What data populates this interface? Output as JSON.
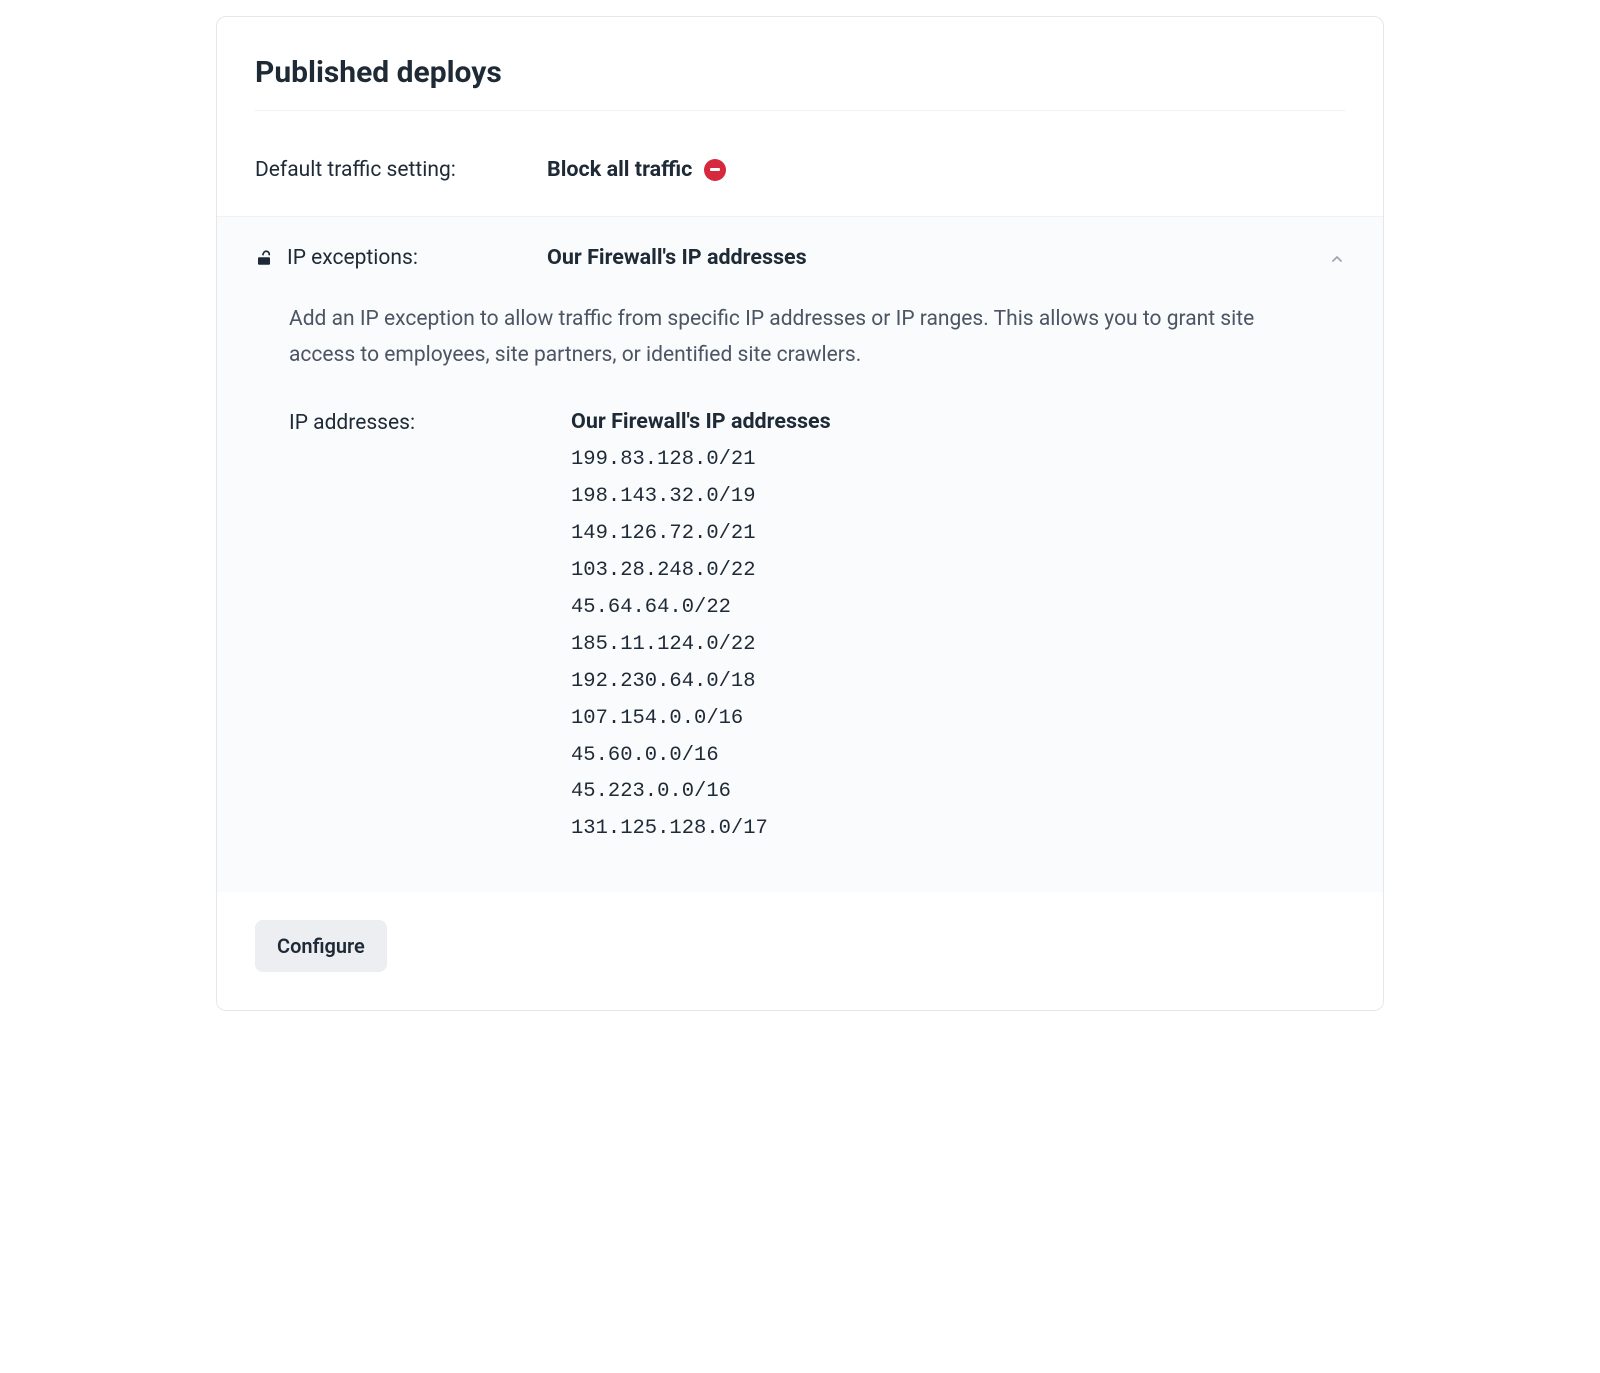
{
  "header": {
    "title": "Published deploys"
  },
  "traffic": {
    "label": "Default traffic setting:",
    "value": "Block all traffic"
  },
  "exceptions": {
    "label": "IP exceptions:",
    "value": "Our Firewall's IP addresses",
    "description": "Add an IP exception to allow traffic from specific IP addresses or IP ranges. This allows you to grant site access to employees, site partners, or identified site crawlers.",
    "ip_label": "IP addresses:",
    "ip_title": "Our Firewall's IP addresses",
    "ip_list": [
      "199.83.128.0/21",
      "198.143.32.0/19",
      "149.126.72.0/21",
      "103.28.248.0/22",
      "45.64.64.0/22",
      "185.11.124.0/22",
      "192.230.64.0/18",
      "107.154.0.0/16",
      "45.60.0.0/16",
      "45.223.0.0/16",
      "131.125.128.0/17"
    ]
  },
  "footer": {
    "configure_label": "Configure"
  }
}
